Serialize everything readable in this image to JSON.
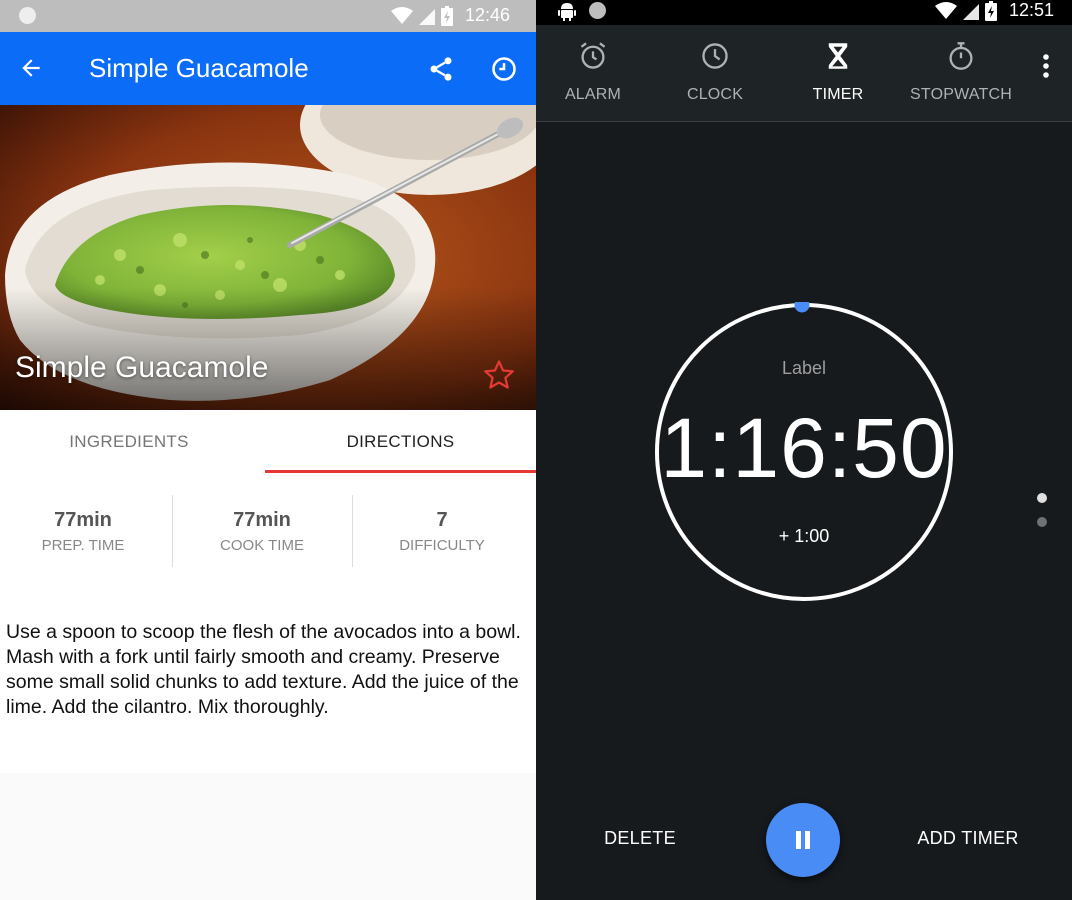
{
  "left": {
    "status": {
      "time": "12:46"
    },
    "appbar": {
      "title": "Simple Guacamole",
      "back_icon": "arrow-back-icon",
      "share_icon": "share-icon",
      "history_icon": "clock-icon"
    },
    "hero": {
      "title": "Simple Guacamole",
      "favorite_icon": "star-outline-icon",
      "favorite_color": "#e53935"
    },
    "tabs": [
      {
        "label": "INGREDIENTS",
        "selected": false
      },
      {
        "label": "DIRECTIONS",
        "selected": true
      }
    ],
    "stats": [
      {
        "value": "77min",
        "label": "PREP. TIME"
      },
      {
        "value": "77min",
        "label": "COOK TIME"
      },
      {
        "value": "7",
        "label": "DIFFICULTY"
      }
    ],
    "directions": "Use a spoon to scoop the flesh of the avocados into a bowl. Mash with a fork until fairly smooth and creamy. Preserve some small solid chunks to add texture. Add the juice of the lime. Add the cilantro. Mix thoroughly.",
    "colors": {
      "appbar": "#0a6cf7",
      "tab_indicator": "#e53935"
    }
  },
  "right": {
    "status": {
      "time": "12:51"
    },
    "tabs": [
      {
        "label": "ALARM",
        "icon": "alarm-icon",
        "selected": false
      },
      {
        "label": "CLOCK",
        "icon": "clock-icon",
        "selected": false
      },
      {
        "label": "TIMER",
        "icon": "hourglass-icon",
        "selected": true
      },
      {
        "label": "STOPWATCH",
        "icon": "stopwatch-icon",
        "selected": false
      }
    ],
    "timer": {
      "label": "Label",
      "time": "1:16:50",
      "add_minute": "+ 1:00"
    },
    "actions": {
      "delete": "DELETE",
      "pause_icon": "pause-icon",
      "add_timer": "ADD TIMER"
    },
    "colors": {
      "background": "#161a1d",
      "accent": "#4a8cf6"
    }
  }
}
